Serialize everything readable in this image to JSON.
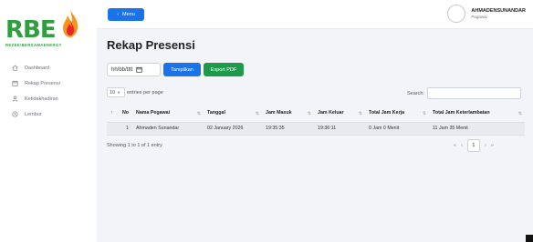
{
  "brand": {
    "logo_text": "RBE",
    "tagline": "REZEKIBERSAMAENERGY",
    "color": "#2e9e3f"
  },
  "sidebar": {
    "items": [
      {
        "label": "Dashboard",
        "icon": "home-icon"
      },
      {
        "label": "Rekap Presensi",
        "icon": "calendar-icon"
      },
      {
        "label": "Ketidakhadiran",
        "icon": "person-icon"
      },
      {
        "label": "Lembur",
        "icon": "clock-icon"
      }
    ]
  },
  "topbar": {
    "menu_label": "Menu",
    "user_name": "AHMADENSUNANDAR",
    "user_role": "Pegawai"
  },
  "page": {
    "title": "Rekap Presensi"
  },
  "filter": {
    "date_placeholder": "hh/bb/tttt",
    "show_label": "Tampilkan",
    "export_label": "Export PDF"
  },
  "table_controls": {
    "entries_value": "10",
    "entries_suffix": "entries per page",
    "search_label": "Search:"
  },
  "table": {
    "headers": [
      "No",
      "Nama Pegawai",
      "Tanggal",
      "Jam Masuk",
      "Jam Keluar",
      "Total Jam Kerja",
      "Total Jam Keterlambatan"
    ],
    "rows": [
      [
        "1",
        "Ahmaden Sunandar",
        "02 January 2026",
        "19:35:35",
        "19:36:11",
        "0 Jam 0 Menit",
        "11 Jam 35 Menit"
      ]
    ]
  },
  "footer": {
    "showing": "Showing 1 to 1 of 1 entry",
    "first": "«",
    "prev": "‹",
    "page": "1",
    "next": "›",
    "last": "»"
  },
  "colors": {
    "primary": "#1a73e8",
    "success": "#1e9b4a"
  }
}
